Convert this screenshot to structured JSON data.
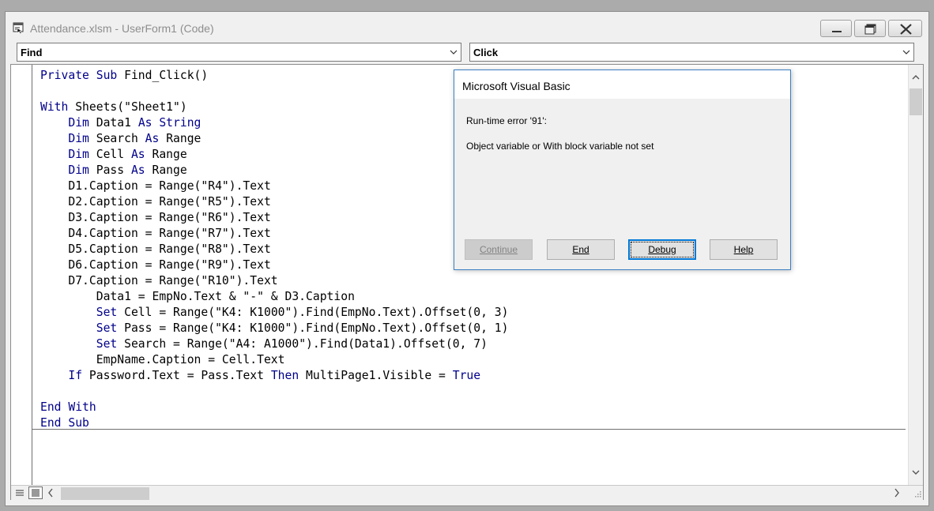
{
  "window": {
    "title": "Attendance.xlsm - UserForm1 (Code)"
  },
  "toolbar": {
    "object_combo": "Find",
    "procedure_combo": "Click"
  },
  "code": {
    "lines": [
      [
        [
          "kw",
          "Private Sub "
        ],
        [
          "tx",
          "Find_Click()"
        ]
      ],
      [],
      [
        [
          "kw",
          "With "
        ],
        [
          "tx",
          "Sheets(\"Sheet1\")"
        ]
      ],
      [
        [
          "tx",
          "    "
        ],
        [
          "kw",
          "Dim "
        ],
        [
          "tx",
          "Data1 "
        ],
        [
          "kw",
          "As String"
        ]
      ],
      [
        [
          "tx",
          "    "
        ],
        [
          "kw",
          "Dim "
        ],
        [
          "tx",
          "Search "
        ],
        [
          "kw",
          "As "
        ],
        [
          "tx",
          "Range"
        ]
      ],
      [
        [
          "tx",
          "    "
        ],
        [
          "kw",
          "Dim "
        ],
        [
          "tx",
          "Cell "
        ],
        [
          "kw",
          "As "
        ],
        [
          "tx",
          "Range"
        ]
      ],
      [
        [
          "tx",
          "    "
        ],
        [
          "kw",
          "Dim "
        ],
        [
          "tx",
          "Pass "
        ],
        [
          "kw",
          "As "
        ],
        [
          "tx",
          "Range"
        ]
      ],
      [
        [
          "tx",
          "    D1.Caption = Range(\"R4\").Text"
        ]
      ],
      [
        [
          "tx",
          "    D2.Caption = Range(\"R5\").Text"
        ]
      ],
      [
        [
          "tx",
          "    D3.Caption = Range(\"R6\").Text"
        ]
      ],
      [
        [
          "tx",
          "    D4.Caption = Range(\"R7\").Text"
        ]
      ],
      [
        [
          "tx",
          "    D5.Caption = Range(\"R8\").Text"
        ]
      ],
      [
        [
          "tx",
          "    D6.Caption = Range(\"R9\").Text"
        ]
      ],
      [
        [
          "tx",
          "    D7.Caption = Range(\"R10\").Text"
        ]
      ],
      [
        [
          "tx",
          "        Data1 = EmpNo.Text & \"-\" & D3.Caption"
        ]
      ],
      [
        [
          "tx",
          "        "
        ],
        [
          "kw",
          "Set "
        ],
        [
          "tx",
          "Cell = Range(\"K4: K1000\").Find(EmpNo.Text).Offset(0, 3)"
        ]
      ],
      [
        [
          "tx",
          "        "
        ],
        [
          "kw",
          "Set "
        ],
        [
          "tx",
          "Pass = Range(\"K4: K1000\").Find(EmpNo.Text).Offset(0, 1)"
        ]
      ],
      [
        [
          "tx",
          "        "
        ],
        [
          "kw",
          "Set "
        ],
        [
          "tx",
          "Search = Range(\"A4: A1000\").Find(Data1).Offset(0, 7)"
        ]
      ],
      [
        [
          "tx",
          "        EmpName.Caption = Cell.Text"
        ]
      ],
      [
        [
          "tx",
          "    "
        ],
        [
          "kw",
          "If "
        ],
        [
          "tx",
          "Password.Text = Pass.Text "
        ],
        [
          "kw",
          "Then "
        ],
        [
          "tx",
          "MultiPage1.Visible = "
        ],
        [
          "kw",
          "True"
        ]
      ],
      [],
      [
        [
          "kw",
          "End With"
        ]
      ],
      [
        [
          "kw",
          "End Sub"
        ]
      ]
    ],
    "keyword_color": "#00008b",
    "text_color": "#000000"
  },
  "dialog": {
    "title": "Microsoft Visual Basic",
    "error_line": "Run-time error '91':",
    "message": "Object variable or With block variable not set",
    "buttons": {
      "continue": "Continue",
      "end": "End",
      "debug": "Debug",
      "help": "Help"
    }
  },
  "icons": {
    "app": "vba-module-icon",
    "minimize": "minimize-icon",
    "maximize": "maximize-icon",
    "close": "close-icon"
  }
}
